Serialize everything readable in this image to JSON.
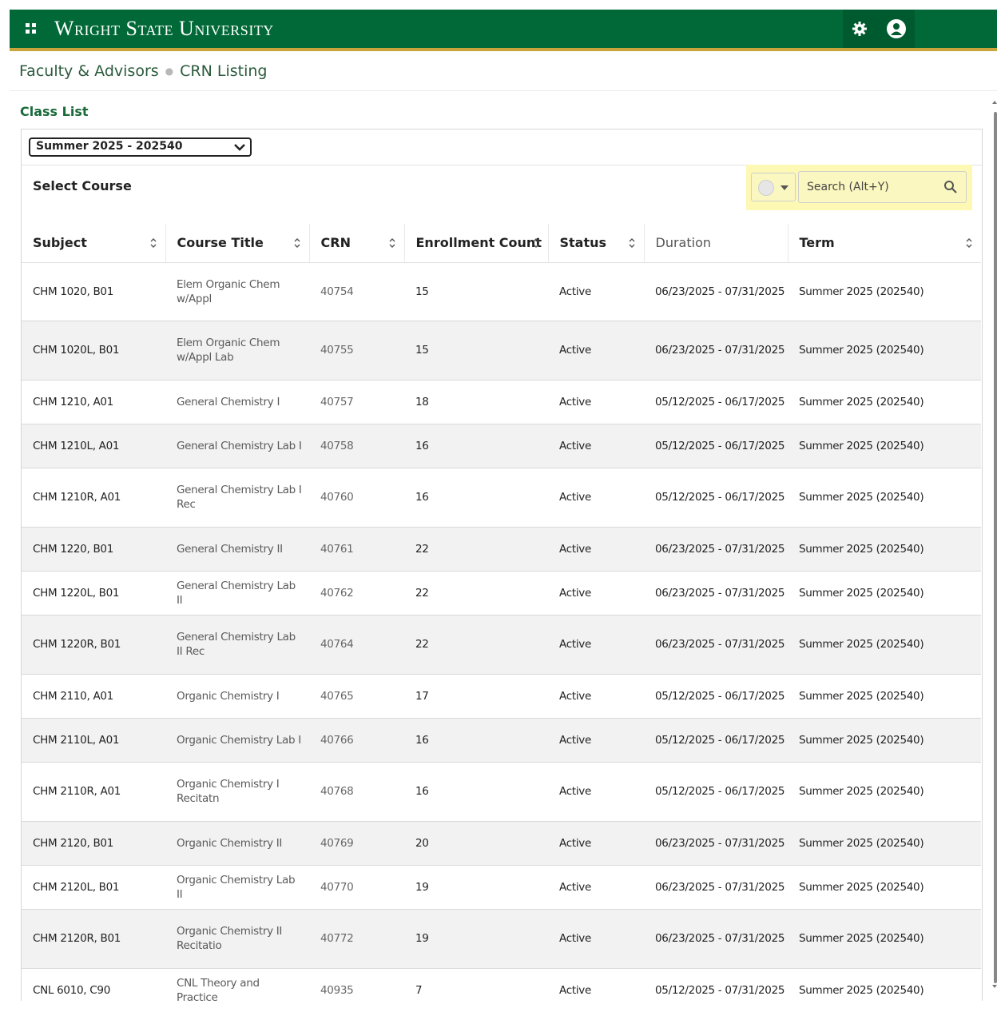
{
  "header": {
    "title": "Wright State University",
    "icons": {
      "menu": "grid-icon",
      "settings": "gear-icon",
      "user": "user-icon"
    }
  },
  "breadcrumb": {
    "first": "Faculty & Advisors",
    "current": "CRN Listing"
  },
  "page": {
    "section_title": "Class List",
    "term_select": {
      "value": "Summer 2025 - 202540"
    },
    "select_course_label": "Select Course",
    "search": {
      "placeholder": "Search (Alt+Y)"
    }
  },
  "table": {
    "columns": [
      "Subject",
      "Course Title",
      "CRN",
      "Enrollment Count",
      "Status",
      "Duration",
      "Term"
    ],
    "rows": [
      {
        "subject": "CHM 1020, B01",
        "title": "Elem Organic Chem w/Appl",
        "crn": "40754",
        "enrollment": "15",
        "status": "Active",
        "duration": "06/23/2025 - 07/31/2025",
        "term": "Summer 2025 (202540)"
      },
      {
        "subject": "CHM 1020L, B01",
        "title": "Elem Organic Chem w/Appl Lab",
        "crn": "40755",
        "enrollment": "15",
        "status": "Active",
        "duration": "06/23/2025 - 07/31/2025",
        "term": "Summer 2025 (202540)"
      },
      {
        "subject": "CHM 1210, A01",
        "title": "General Chemistry I",
        "crn": "40757",
        "enrollment": "18",
        "status": "Active",
        "duration": "05/12/2025 - 06/17/2025",
        "term": "Summer 2025 (202540)"
      },
      {
        "subject": "CHM 1210L, A01",
        "title": "General Chemistry Lab I",
        "crn": "40758",
        "enrollment": "16",
        "status": "Active",
        "duration": "05/12/2025 - 06/17/2025",
        "term": "Summer 2025 (202540)"
      },
      {
        "subject": "CHM 1210R, A01",
        "title": "General Chemistry Lab I Rec",
        "crn": "40760",
        "enrollment": "16",
        "status": "Active",
        "duration": "05/12/2025 - 06/17/2025",
        "term": "Summer 2025 (202540)"
      },
      {
        "subject": "CHM 1220, B01",
        "title": "General Chemistry II",
        "crn": "40761",
        "enrollment": "22",
        "status": "Active",
        "duration": "06/23/2025 - 07/31/2025",
        "term": "Summer 2025 (202540)"
      },
      {
        "subject": "CHM 1220L, B01",
        "title": "General Chemistry Lab II",
        "crn": "40762",
        "enrollment": "22",
        "status": "Active",
        "duration": "06/23/2025 - 07/31/2025",
        "term": "Summer 2025 (202540)"
      },
      {
        "subject": "CHM 1220R, B01",
        "title": "General Chemistry Lab II Rec",
        "crn": "40764",
        "enrollment": "22",
        "status": "Active",
        "duration": "06/23/2025 - 07/31/2025",
        "term": "Summer 2025 (202540)"
      },
      {
        "subject": "CHM 2110, A01",
        "title": "Organic Chemistry I",
        "crn": "40765",
        "enrollment": "17",
        "status": "Active",
        "duration": "05/12/2025 - 06/17/2025",
        "term": "Summer 2025 (202540)"
      },
      {
        "subject": "CHM 2110L, A01",
        "title": "Organic Chemistry Lab I",
        "crn": "40766",
        "enrollment": "16",
        "status": "Active",
        "duration": "05/12/2025 - 06/17/2025",
        "term": "Summer 2025 (202540)"
      },
      {
        "subject": "CHM 2110R, A01",
        "title": "Organic Chemistry I Recitatn",
        "crn": "40768",
        "enrollment": "16",
        "status": "Active",
        "duration": "05/12/2025 - 06/17/2025",
        "term": "Summer 2025 (202540)"
      },
      {
        "subject": "CHM 2120, B01",
        "title": "Organic Chemistry II",
        "crn": "40769",
        "enrollment": "20",
        "status": "Active",
        "duration": "06/23/2025 - 07/31/2025",
        "term": "Summer 2025 (202540)"
      },
      {
        "subject": "CHM 2120L, B01",
        "title": "Organic Chemistry Lab II",
        "crn": "40770",
        "enrollment": "19",
        "status": "Active",
        "duration": "06/23/2025 - 07/31/2025",
        "term": "Summer 2025 (202540)"
      },
      {
        "subject": "CHM 2120R, B01",
        "title": "Organic Chemistry II Recitatio",
        "crn": "40772",
        "enrollment": "19",
        "status": "Active",
        "duration": "06/23/2025 - 07/31/2025",
        "term": "Summer 2025 (202540)"
      },
      {
        "subject": "CNL 6010, C90",
        "title": "CNL Theory and Practice",
        "crn": "40935",
        "enrollment": "7",
        "status": "Active",
        "duration": "05/12/2025 - 07/31/2025",
        "term": "Summer 2025 (202540)"
      }
    ]
  },
  "colors": {
    "brand_green": "#006937",
    "brand_gold": "#c9a33b",
    "search_highlight": "#fdf8b4"
  }
}
